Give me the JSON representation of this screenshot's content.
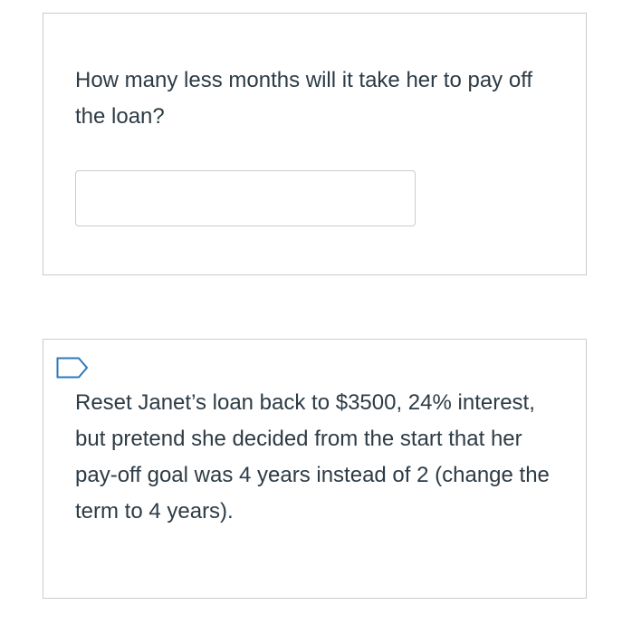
{
  "questions": [
    {
      "text": "How many less months will it take her to pay off the loan?",
      "answer": {
        "value": "",
        "placeholder": ""
      }
    },
    {
      "text": "Reset Janet’s loan back to $3500, 24% interest, but pretend she decided from the start that her pay-off goal was 4 years instead of 2 (change the term to 4 years).",
      "flag_icon": "flag-question-icon"
    }
  ],
  "colors": {
    "border": "#c7cdd1",
    "text": "#2d3b45",
    "flag": "#2b7abc"
  }
}
